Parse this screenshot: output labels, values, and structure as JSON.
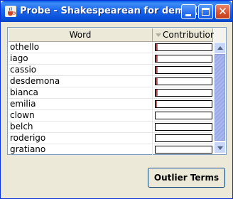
{
  "window": {
    "title": "Probe - Shakespearean for demo (..."
  },
  "table": {
    "columns": [
      "Word",
      "Contribution"
    ],
    "rows": [
      {
        "word": "othello",
        "contribution": 0.04
      },
      {
        "word": "iago",
        "contribution": 0.04
      },
      {
        "word": "cassio",
        "contribution": 0.04
      },
      {
        "word": "desdemona",
        "contribution": 0.04
      },
      {
        "word": "bianca",
        "contribution": 0.04
      },
      {
        "word": "emilia",
        "contribution": 0.03
      },
      {
        "word": "clown",
        "contribution": 0.0
      },
      {
        "word": "belch",
        "contribution": 0.0
      },
      {
        "word": "roderigo",
        "contribution": 0.0
      },
      {
        "word": "gratiano",
        "contribution": 0.0
      }
    ]
  },
  "buttons": {
    "outlier_terms": "Outlier Terms"
  },
  "icons": {
    "app": "java-cup-icon",
    "minimize": "minimize-icon",
    "maximize": "maximize-icon",
    "close": "close-icon",
    "sort": "sort-descending-icon",
    "scroll_up": "arrow-up-icon",
    "scroll_down": "arrow-down-icon"
  },
  "colors": {
    "titlebar": "#0a5ee8",
    "bar_fill": "#d9535c",
    "close_button": "#d8502c"
  }
}
